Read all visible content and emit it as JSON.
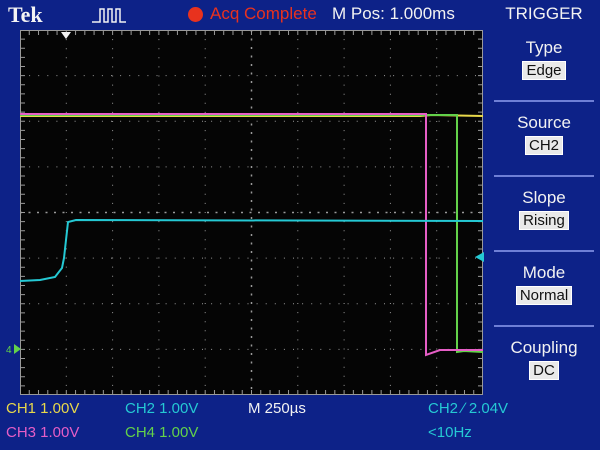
{
  "header": {
    "brand": "Tek",
    "acq_status": "Acq Complete",
    "position": "M Pos: 1.000ms"
  },
  "trigger_menu": {
    "title": "TRIGGER",
    "items": [
      {
        "label": "Type",
        "value": "Edge"
      },
      {
        "label": "Source",
        "value": "CH2"
      },
      {
        "label": "Slope",
        "value": "Rising"
      },
      {
        "label": "Mode",
        "value": "Normal"
      },
      {
        "label": "Coupling",
        "value": "DC"
      }
    ]
  },
  "readout": {
    "ch1": "CH1  1.00V",
    "ch2": "CH2  1.00V",
    "ch3": "CH3  1.00V",
    "ch4": "CH4  1.00V",
    "timebase": "M 250µs",
    "trigger": "CH2 ∕ 2.04V",
    "frequency": "<10Hz"
  },
  "colors": {
    "ch1": "#e8d84a",
    "ch2": "#25c9d4",
    "ch3": "#e65ec6",
    "ch4": "#63d24a",
    "acq": "#e8321e",
    "bezel": "#0d2288",
    "graticule": "#050505"
  },
  "icons": {
    "trigger_waveform": "pulse-icon",
    "acq_indicator": "red-dot-icon",
    "trigger_position": "down-triangle-icon",
    "ch2_ground": "left-arrow-icon",
    "ch4_ground": "ground-marker-icon"
  }
}
